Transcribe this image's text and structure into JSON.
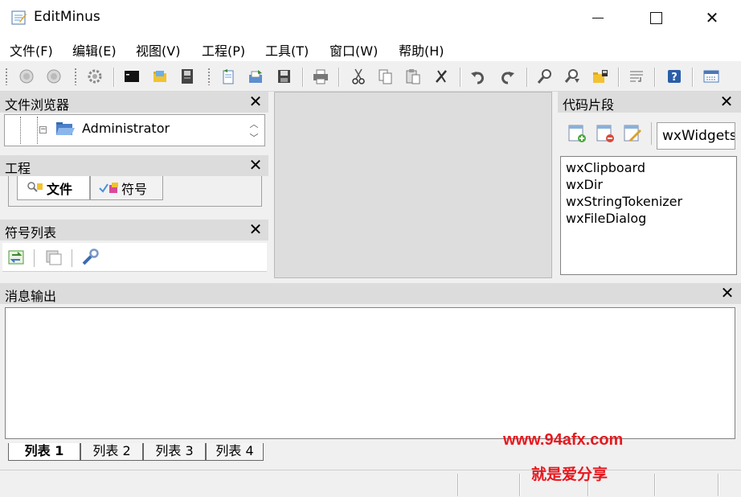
{
  "window": {
    "title": "EditMinus",
    "controls": {
      "minimize": "–",
      "maximize": "□",
      "close": "✕"
    }
  },
  "menu": [
    {
      "label": "文件(F)"
    },
    {
      "label": "编辑(E)"
    },
    {
      "label": "视图(V)"
    },
    {
      "label": "工程(P)"
    },
    {
      "label": "工具(T)"
    },
    {
      "label": "窗口(W)"
    },
    {
      "label": "帮助(H)"
    }
  ],
  "toolbar": {
    "icons": [
      "back-icon",
      "forward-icon",
      "settings-gear-icon",
      "console-icon",
      "open-folder-icon",
      "save-disk-icon",
      "new-file-icon",
      "open-file-icon",
      "save-icon",
      "print-icon",
      "cut-icon",
      "copy-icon",
      "paste-icon",
      "delete-icon",
      "undo-icon",
      "redo-icon",
      "find-icon",
      "find-replace-icon",
      "folder-lock-icon",
      "wrap-icon",
      "help-icon",
      "preferences-icon"
    ]
  },
  "panels": {
    "file_browser": {
      "title": "文件浏览器",
      "close": "✕",
      "root": "Administrator"
    },
    "project": {
      "title": "工程",
      "close": "✕",
      "tabs": [
        "文件",
        "符号"
      ]
    },
    "symbol_list": {
      "title": "符号列表",
      "close": "✕"
    },
    "snippets": {
      "title": "代码片段",
      "close": "✕",
      "combo_value": "wxWidgets",
      "items": [
        "wxClipboard",
        "wxDir",
        "wxStringTokenizer",
        "wxFileDialog"
      ]
    },
    "messages": {
      "title": "消息输出",
      "close": "✕",
      "tabs": [
        "列表 1",
        "列表 2",
        "列表 3",
        "列表 4"
      ]
    }
  },
  "watermark": {
    "line1": "www.94afx.com",
    "line2": "就是爱分享"
  },
  "colors": {
    "accent_red": "#e8181e",
    "panel_header": "#dcdcdc"
  }
}
